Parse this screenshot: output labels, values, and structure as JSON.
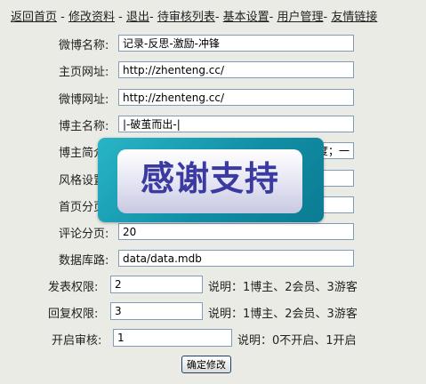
{
  "nav": {
    "items": [
      {
        "label": "返回首页",
        "sep": " - "
      },
      {
        "label": "修改资料",
        "sep": " - "
      },
      {
        "label": "退出",
        "sep": "- "
      },
      {
        "label": "待审核列表",
        "sep": "- "
      },
      {
        "label": "基本设置",
        "sep": "- "
      },
      {
        "label": "用户管理",
        "sep": "- "
      },
      {
        "label": "友情链接",
        "sep": ""
      }
    ]
  },
  "form": {
    "blog_name": {
      "label": "微博名称:",
      "value": "记录-反思-激励-冲锋"
    },
    "home_url": {
      "label": "主页网址:",
      "value": "http://zhenteng.cc/"
    },
    "blog_url": {
      "label": "微博网址:",
      "value": "http://zhenteng.cc/"
    },
    "owner_name": {
      "label": "博主名称:",
      "value": "|-破茧而出-|"
    },
    "owner_intro": {
      "label": "博主简介:",
      "value": "度；一"
    },
    "style": {
      "label": "风格设置:",
      "value": ""
    },
    "home_page": {
      "label": "首页分页:",
      "value": ""
    },
    "comment_page": {
      "label": "评论分页:",
      "value": "20"
    },
    "database": {
      "label": "数据库路:",
      "value": "data/data.mdb"
    },
    "post_perm": {
      "label": "发表权限:",
      "value": "2",
      "note": "说明：1博主、2会员、3游客"
    },
    "reply_perm": {
      "label": "回复权限:",
      "value": "3",
      "note": "说明：1博主、2会员、3游客"
    },
    "audit": {
      "label": "开启审核:",
      "value": "1",
      "note": "说明：0不开启、1开启"
    },
    "submit_label": "确定修改"
  },
  "overlay": {
    "text": "感谢支持"
  },
  "colors": {
    "page_bg": "#ebebe6",
    "badge_teal": "#118fa6",
    "badge_text": "#3a3aa0",
    "input_border": "#7f9db9"
  }
}
